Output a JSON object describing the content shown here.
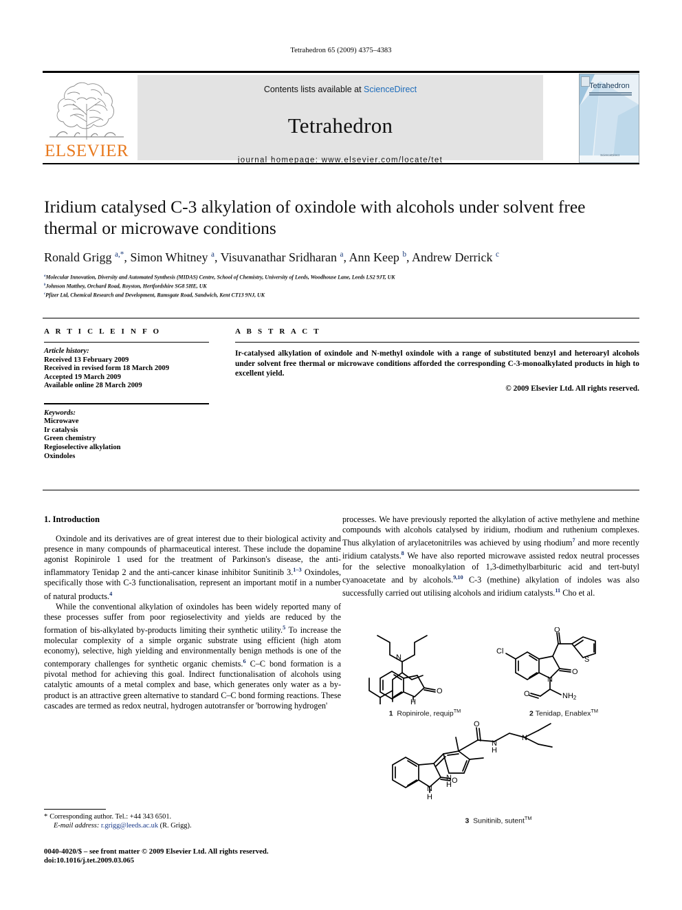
{
  "running_head": "Tetrahedron 65 (2009) 4375–4383",
  "banner": {
    "publisher_name": "ELSEVIER",
    "contents_prefix": "Contents lists available at ",
    "contents_link": "ScienceDirect",
    "journal_title": "Tetrahedron",
    "homepage": "journal homepage: www.elsevier.com/locate/tet",
    "cover_title": "Tetrahedron",
    "cover_footer": "ScienceDirect",
    "link_color": "#1c6bba",
    "elsevier_orange": "#E8791E"
  },
  "article": {
    "title": "Iridium catalysed C-3 alkylation of oxindole with alcohols under solvent free thermal or microwave conditions",
    "authors_html": "Ronald Grigg <sup>a,</sup><sup>*</sup>, Simon Whitney <sup>a</sup>, Visuvanathar Sridharan <sup>a</sup>, Ann Keep <sup>b</sup>, Andrew Derrick <sup>c</sup>",
    "affiliations": [
      "Molecular Innovation, Diversity and Automated Synthesis (MIDAS) Centre, School of Chemistry, University of Leeds, Woodhouse Lane, Leeds LS2 9JT, UK",
      "Johnson Matthey, Orchard Road, Royston, Hertfordshire SG8 5HE, UK",
      "Pfizer Ltd, Chemical Research and Development, Ramsgate Road, Sandwich, Kent CT13 9NJ, UK"
    ],
    "affiliation_marks": [
      "a",
      "b",
      "c"
    ]
  },
  "article_info": {
    "heading": "A R T I C L E  I N F O",
    "history_label": "Article history:",
    "history": [
      "Received 13 February 2009",
      "Received in revised form 18 March 2009",
      "Accepted 19 March 2009",
      "Available online 28 March 2009"
    ],
    "keywords_label": "Keywords:",
    "keywords": [
      "Microwave",
      "Ir catalysis",
      "Green chemistry",
      "Regioselective alkylation",
      "Oxindoles"
    ]
  },
  "abstract": {
    "heading": "A B S T R A C T",
    "text": "Ir-catalysed alkylation of oxindole and N-methyl oxindole with a range of substituted benzyl and heteroaryl alcohols under solvent free thermal or microwave conditions afforded the corresponding C-3-monoalkylated products in high to excellent yield.",
    "copyright": "© 2009 Elsevier Ltd. All rights reserved."
  },
  "body": {
    "section_number_title": "1. Introduction",
    "left_paragraph_1": "Oxindole and its derivatives are of great interest due to their biological activity and presence in many compounds of pharmaceutical interest. These include the dopamine agonist Ropinirole 1 used for the treatment of Parkinson's disease, the anti-inflammatory Tenidap 2 and the anti-cancer kinase inhibitor Sunitinib 3.",
    "left_paragraph_1_ref1": "1–3",
    "left_paragraph_1_tail": " Oxindoles, specifically those with C-3 functionalisation, represent an important motif in a number of natural products.",
    "left_paragraph_1_ref2": "4",
    "left_paragraph_2_a": "While the conventional alkylation of oxindoles has been widely reported many of these processes suffer from poor regioselectivity and yields are reduced by the formation of bis-alkylated by-products limiting their synthetic utility.",
    "left_paragraph_2_ref1": "5",
    "left_paragraph_2_b": " To increase the molecular complexity of a simple organic substrate using efficient (high atom economy), selective, high yielding and environmentally benign methods is one of the contemporary challenges for synthetic organic chemists.",
    "left_paragraph_2_ref2": "6",
    "left_paragraph_2_c": " C–C bond formation is a pivotal method for achieving this goal. Indirect functionalisation of alcohols using catalytic amounts of a metal complex and base, which generates only water as a by-product is an attractive green alternative to standard C–C bond forming reactions. These cascades are termed as redox neutral, hydrogen autotransfer or 'borrowing hydrogen'",
    "right_paragraph_a": "processes. We have previously reported the alkylation of active methylene and methine compounds with alcohols catalysed by iridium, rhodium and ruthenium complexes. Thus alkylation of arylacetonitriles was achieved by using rhodium",
    "right_ref1": "7",
    "right_paragraph_b": " and more recently iridium catalysts.",
    "right_ref2": "8",
    "right_paragraph_c": " We have also reported microwave assisted redox neutral processes for the selective monoalkylation of 1,3-dimethylbarbituric acid and tert-butyl cyanoacetate and by alcohols.",
    "right_ref3": "9,10",
    "right_paragraph_d": " C-3 (methine) alkylation of indoles was also successfully carried out utilising alcohols and iridium catalysts.",
    "right_ref4": "11",
    "right_paragraph_e": " Cho et al."
  },
  "structures": [
    {
      "number": "1",
      "name": "Ropinirole, requip",
      "trademark": "TM",
      "atom_labels": [
        "N",
        "O",
        "H"
      ]
    },
    {
      "number": "2",
      "name": "Tenidap, Enablex",
      "trademark": "TM",
      "atom_labels": [
        "Cl",
        "O",
        "S",
        "N",
        "NH2"
      ]
    },
    {
      "number": "3",
      "name": "Sunitinib, sutent",
      "trademark": "TM",
      "atom_labels": [
        "O",
        "N",
        "H"
      ]
    }
  ],
  "footnote": {
    "star": "*",
    "corresponding": "Corresponding author. Tel.: +44 343 6501.",
    "email_label": "E-mail address:",
    "email": "r.grigg@leeds.ac.uk",
    "email_owner": "(R. Grigg)."
  },
  "issn_line_1": "0040-4020/$ – see front matter © 2009 Elsevier Ltd. All rights reserved.",
  "issn_line_2": "doi:10.1016/j.tet.2009.03.065"
}
